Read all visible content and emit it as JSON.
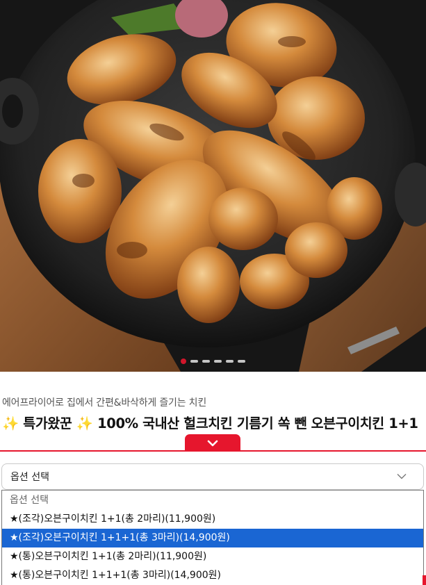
{
  "hero": {
    "image_alt": "",
    "carousel": {
      "total": 6,
      "active_index": 0
    }
  },
  "product": {
    "subtitle": "에어프라이어로 집에서 간편&바삭하게 즐기는 치킨",
    "title_spark_left": "✨",
    "title_badge": "특가왔꾼",
    "title_spark_right": "✨",
    "title_main": "100% 국내산 헐크치킨 기름기 쏙 뺀 오븐구이치킨 1+1"
  },
  "option_select": {
    "selected_label": "옵션 선택",
    "options": [
      {
        "label": "옵션 선택",
        "placeholder": true
      },
      {
        "label": "★(조각)오븐구이치킨 1+1(총 2마리)(11,900원)"
      },
      {
        "label": "★(조각)오븐구이치킨 1+1+1(총 3마리)(14,900원)",
        "highlighted": true
      },
      {
        "label": "★(통)오븐구이치킨 1+1(총 2마리)(11,900원)"
      },
      {
        "label": "★(통)오븐구이치킨 1+1+1(총 3마리)(14,900원)"
      }
    ]
  },
  "colors": {
    "accent": "#e6162d",
    "option_highlight": "#1a66d3"
  },
  "icons": {
    "toggle_tab": "chevron-down-icon",
    "select_arrow": "chevron-down-icon"
  }
}
